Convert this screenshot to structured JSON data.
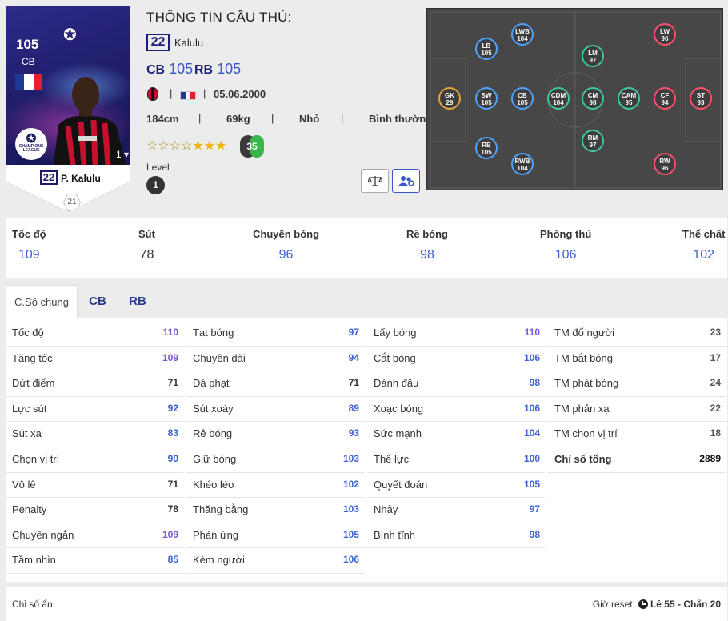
{
  "card": {
    "ovr": "105",
    "position": "CB",
    "ucl_badge_text": "CHAMPIONS LEAGUE",
    "level_select": "1",
    "jersey": "22",
    "name": "P. Kalulu",
    "rank": "21",
    "flag_colors": [
      "#1f3a93",
      "#ffffff",
      "#e4202e"
    ]
  },
  "info": {
    "title": "THÔNG TIN CẦU THỦ:",
    "jersey": "22",
    "short_name": "Kalulu",
    "positions": [
      {
        "pos": "CB",
        "rating": "105"
      },
      {
        "pos": "RB",
        "rating": "105"
      }
    ],
    "sep": "|",
    "dob": "05.06.2000",
    "height": "184cm",
    "weight": "69kg",
    "body": "Nhỏ",
    "body_type": "Bình thường",
    "stars_total": 7,
    "stars_filled": 3,
    "skill_moves": "3",
    "weak_foot": "5",
    "level_label": "Level",
    "level": "1",
    "icons": [
      "scale-icon",
      "people-gear-icon"
    ]
  },
  "pitch": {
    "nodes": [
      {
        "pos": "GK",
        "val": "29",
        "group": "gk"
      },
      {
        "pos": "LB",
        "val": "105",
        "group": "def"
      },
      {
        "pos": "SW",
        "val": "105",
        "group": "def"
      },
      {
        "pos": "RB",
        "val": "105",
        "group": "def"
      },
      {
        "pos": "LWB",
        "val": "104",
        "group": "def"
      },
      {
        "pos": "CB",
        "val": "105",
        "group": "def"
      },
      {
        "pos": "RWB",
        "val": "104",
        "group": "def"
      },
      {
        "pos": "CDM",
        "val": "104",
        "group": "mid"
      },
      {
        "pos": "LM",
        "val": "97",
        "group": "mid"
      },
      {
        "pos": "CM",
        "val": "98",
        "group": "mid"
      },
      {
        "pos": "RM",
        "val": "97",
        "group": "mid"
      },
      {
        "pos": "CAM",
        "val": "95",
        "group": "mid"
      },
      {
        "pos": "LW",
        "val": "96",
        "group": "att"
      },
      {
        "pos": "CF",
        "val": "94",
        "group": "att"
      },
      {
        "pos": "RW",
        "val": "96",
        "group": "att"
      },
      {
        "pos": "ST",
        "val": "93",
        "group": "att"
      }
    ]
  },
  "summary": [
    {
      "label": "Tốc độ",
      "value": "109"
    },
    {
      "label": "Sút",
      "value": "78"
    },
    {
      "label": "Chuyền bóng",
      "value": "96"
    },
    {
      "label": "Rê bóng",
      "value": "98"
    },
    {
      "label": "Phòng thủ",
      "value": "106"
    },
    {
      "label": "Thể chất",
      "value": "102"
    }
  ],
  "tabs": [
    "C.Số chung",
    "CB",
    "RB"
  ],
  "stats": [
    [
      {
        "n": "Tốc độ",
        "v": "110"
      },
      {
        "n": "Tăng tốc",
        "v": "109"
      },
      {
        "n": "Dứt điểm",
        "v": "71"
      },
      {
        "n": "Lực sút",
        "v": "92"
      },
      {
        "n": "Sút xa",
        "v": "83"
      },
      {
        "n": "Chọn vị trí",
        "v": "90"
      },
      {
        "n": "Vô lê",
        "v": "71"
      },
      {
        "n": "Penalty",
        "v": "78"
      },
      {
        "n": "Chuyền ngắn",
        "v": "109"
      },
      {
        "n": "Tầm nhìn",
        "v": "85"
      }
    ],
    [
      {
        "n": "Tạt bóng",
        "v": "97"
      },
      {
        "n": "Chuyền dài",
        "v": "94"
      },
      {
        "n": "Đá phạt",
        "v": "71"
      },
      {
        "n": "Sút xoáy",
        "v": "89"
      },
      {
        "n": "Rê bóng",
        "v": "93"
      },
      {
        "n": "Giữ bóng",
        "v": "103"
      },
      {
        "n": "Khéo léo",
        "v": "102"
      },
      {
        "n": "Thăng bằng",
        "v": "103"
      },
      {
        "n": "Phản ứng",
        "v": "105"
      },
      {
        "n": "Kèm người",
        "v": "106"
      }
    ],
    [
      {
        "n": "Lấy bóng",
        "v": "110"
      },
      {
        "n": "Cắt bóng",
        "v": "106"
      },
      {
        "n": "Đánh đầu",
        "v": "98"
      },
      {
        "n": "Xoạc bóng",
        "v": "106"
      },
      {
        "n": "Sức mạnh",
        "v": "104"
      },
      {
        "n": "Thể lực",
        "v": "100"
      },
      {
        "n": "Quyết đoán",
        "v": "105"
      },
      {
        "n": "Nhảy",
        "v": "97"
      },
      {
        "n": "Bình tĩnh",
        "v": "98"
      }
    ],
    [
      {
        "n": "TM đổ người",
        "v": "23"
      },
      {
        "n": "TM bắt bóng",
        "v": "17"
      },
      {
        "n": "TM phát bóng",
        "v": "24"
      },
      {
        "n": "TM phản xạ",
        "v": "22"
      },
      {
        "n": "TM chọn vị trí",
        "v": "18"
      },
      {
        "n": "Chỉ số tổng",
        "v": "2889"
      }
    ]
  ],
  "footer": {
    "hidden_label": "Chỉ số ẩn:",
    "reset_label": "Giờ reset:",
    "reset_value": "Lẻ 55 - Chẵn 20"
  }
}
